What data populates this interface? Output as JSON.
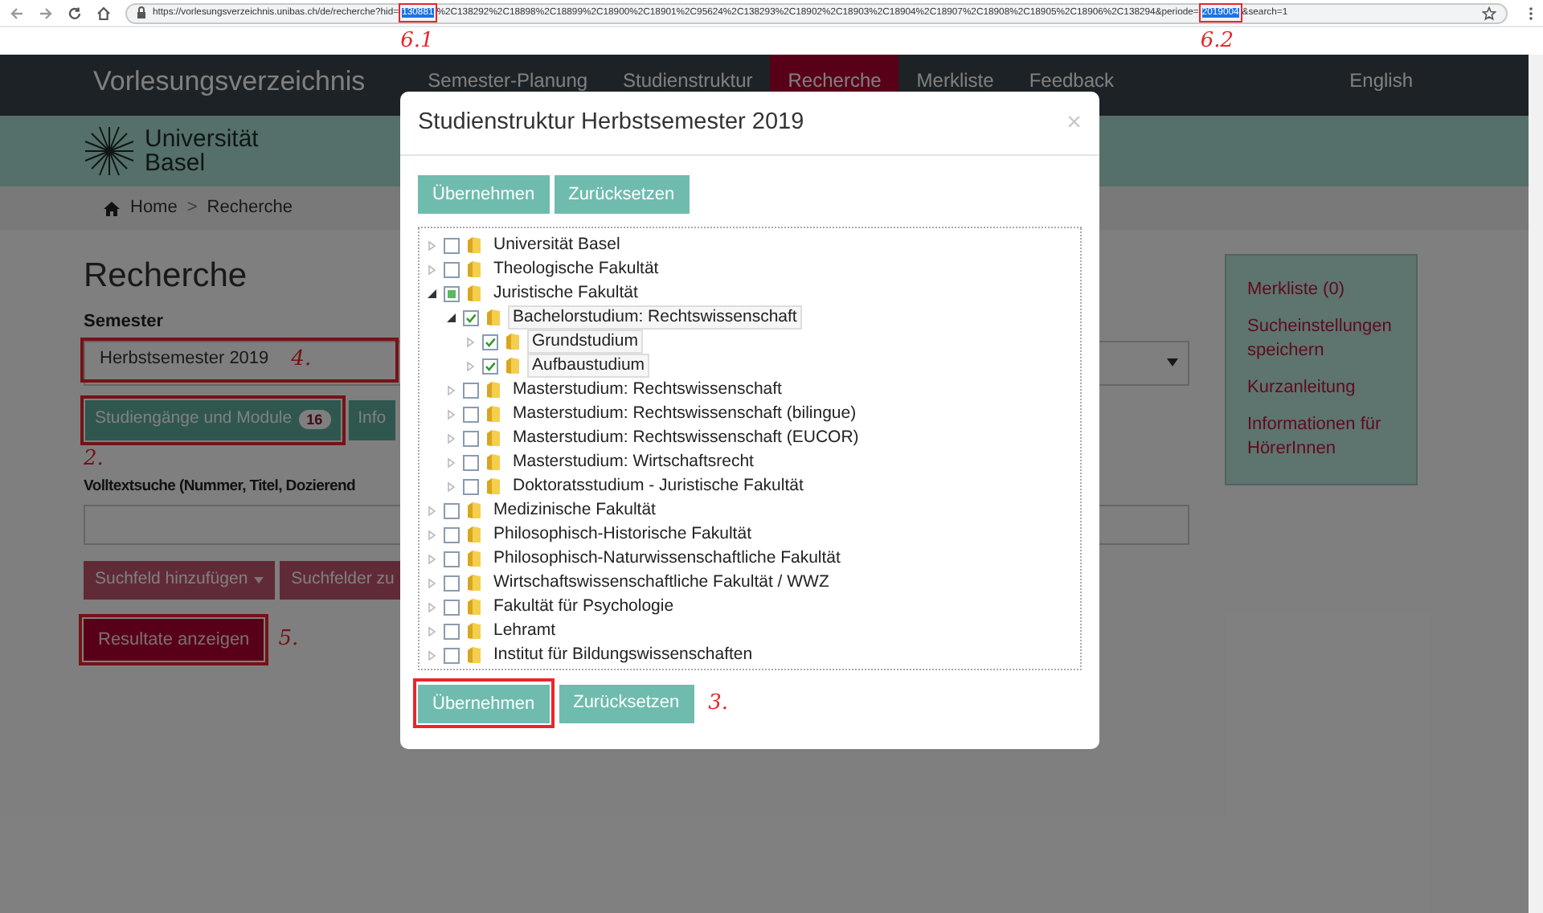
{
  "browser": {
    "url_parts": [
      {
        "text": "https://vorlesungsverzeichnis.unibas.ch/de/recherche?hid=",
        "highlighted": false
      },
      {
        "text": "130881",
        "highlighted": true,
        "annotation": "6.1"
      },
      {
        "text": "%2C138292%2C18898%2C18899%2C18900%2C18901%2C95624%2C138293%2C18902%2C18903%2C18904%2C18907%2C18908%2C18905%2C18906%2C138294&periode=",
        "highlighted": false
      },
      {
        "text": "2019004",
        "highlighted": true,
        "annotation": "6.2"
      },
      {
        "text": "&search=1",
        "highlighted": false
      }
    ]
  },
  "nav": {
    "brand": "Vorlesungsverzeichnis",
    "items": [
      {
        "label": "Semester-Planung",
        "selected": false
      },
      {
        "label": "Studienstruktur",
        "selected": false
      },
      {
        "label": "Recherche",
        "selected": true
      },
      {
        "label": "Merkliste",
        "selected": false
      },
      {
        "label": "Feedback",
        "selected": false
      }
    ],
    "language": "English"
  },
  "logo": {
    "line_1": "Universität",
    "line_2": "Basel"
  },
  "breadcrumb": {
    "items": [
      "Home",
      "Recherche"
    ],
    "separator": ">"
  },
  "page": {
    "title": "Recherche",
    "semester_label": "Semester",
    "semester": {
      "value": "Herbstsemester 2019",
      "framed": true,
      "annotation": "4."
    },
    "tabs": [
      {
        "label": "Studiengänge und Module",
        "badge": "16",
        "framed": true
      },
      {
        "label": "Info",
        "framed": false
      }
    ],
    "tabs_annotation": "2.",
    "fulltext_label": "Volltextsuche (Nummer, Titel, Dozierend",
    "buttons": [
      {
        "label": "Suchfeld hinzufügen",
        "kind": "dropdown"
      },
      {
        "label": "Suchfelder zu",
        "kind": "plain"
      }
    ],
    "submit": {
      "label": "Resultate anzeigen",
      "framed": true,
      "annotation": "5."
    }
  },
  "sidebar": {
    "links": [
      "Merkliste (0)",
      "Sucheinstellungen speichern",
      "Kurzanleitung",
      "Informationen für HörerInnen"
    ]
  },
  "modal": {
    "title": "Studienstruktur Herbstsemester 2019",
    "close": "×",
    "top_buttons": [
      {
        "label": "Übernehmen",
        "framed": false
      },
      {
        "label": "Zurücksetzen",
        "framed": false
      }
    ],
    "tree": [
      {
        "label": "Universität Basel",
        "checked": false,
        "partial": false,
        "expanded": false,
        "selected": false
      },
      {
        "label": "Theologische Fakultät",
        "checked": false,
        "partial": false,
        "expanded": false,
        "selected": false
      },
      {
        "label": "Juristische Fakultät",
        "checked": false,
        "partial": true,
        "expanded": true,
        "selected": false,
        "children": [
          {
            "label": "Bachelorstudium: Rechtswissenschaft",
            "checked": true,
            "partial": false,
            "expanded": true,
            "selected": true,
            "children": [
              {
                "label": "Grundstudium",
                "checked": true,
                "partial": false,
                "expanded": false,
                "selected": true
              },
              {
                "label": "Aufbaustudium",
                "checked": true,
                "partial": false,
                "expanded": false,
                "selected": true
              }
            ]
          },
          {
            "label": "Masterstudium: Rechtswissenschaft",
            "checked": false,
            "partial": false,
            "expanded": false,
            "selected": false
          },
          {
            "label": "Masterstudium: Rechtswissenschaft (bilingue)",
            "checked": false,
            "partial": false,
            "expanded": false,
            "selected": false
          },
          {
            "label": "Masterstudium: Rechtswissenschaft (EUCOR)",
            "checked": false,
            "partial": false,
            "expanded": false,
            "selected": false
          },
          {
            "label": "Masterstudium: Wirtschaftsrecht",
            "checked": false,
            "partial": false,
            "expanded": false,
            "selected": false
          },
          {
            "label": "Doktoratsstudium - Juristische Fakultät",
            "checked": false,
            "partial": false,
            "expanded": false,
            "selected": false
          }
        ]
      },
      {
        "label": "Medizinische Fakultät",
        "checked": false,
        "partial": false,
        "expanded": false,
        "selected": false
      },
      {
        "label": "Philosophisch-Historische Fakultät",
        "checked": false,
        "partial": false,
        "expanded": false,
        "selected": false
      },
      {
        "label": "Philosophisch-Naturwissenschaftliche Fakultät",
        "checked": false,
        "partial": false,
        "expanded": false,
        "selected": false
      },
      {
        "label": "Wirtschaftswissenschaftliche Fakultät / WWZ",
        "checked": false,
        "partial": false,
        "expanded": false,
        "selected": false
      },
      {
        "label": "Fakultät für Psychologie",
        "checked": false,
        "partial": false,
        "expanded": false,
        "selected": false
      },
      {
        "label": "Lehramt",
        "checked": false,
        "partial": false,
        "expanded": false,
        "selected": false
      },
      {
        "label": "Institut für Bildungswissenschaften",
        "checked": false,
        "partial": false,
        "expanded": false,
        "selected": false
      }
    ],
    "bottom_buttons": [
      {
        "label": "Übernehmen",
        "framed": true
      },
      {
        "label": "Zurücksetzen",
        "framed": false
      }
    ],
    "bottom_annotation": "3."
  }
}
